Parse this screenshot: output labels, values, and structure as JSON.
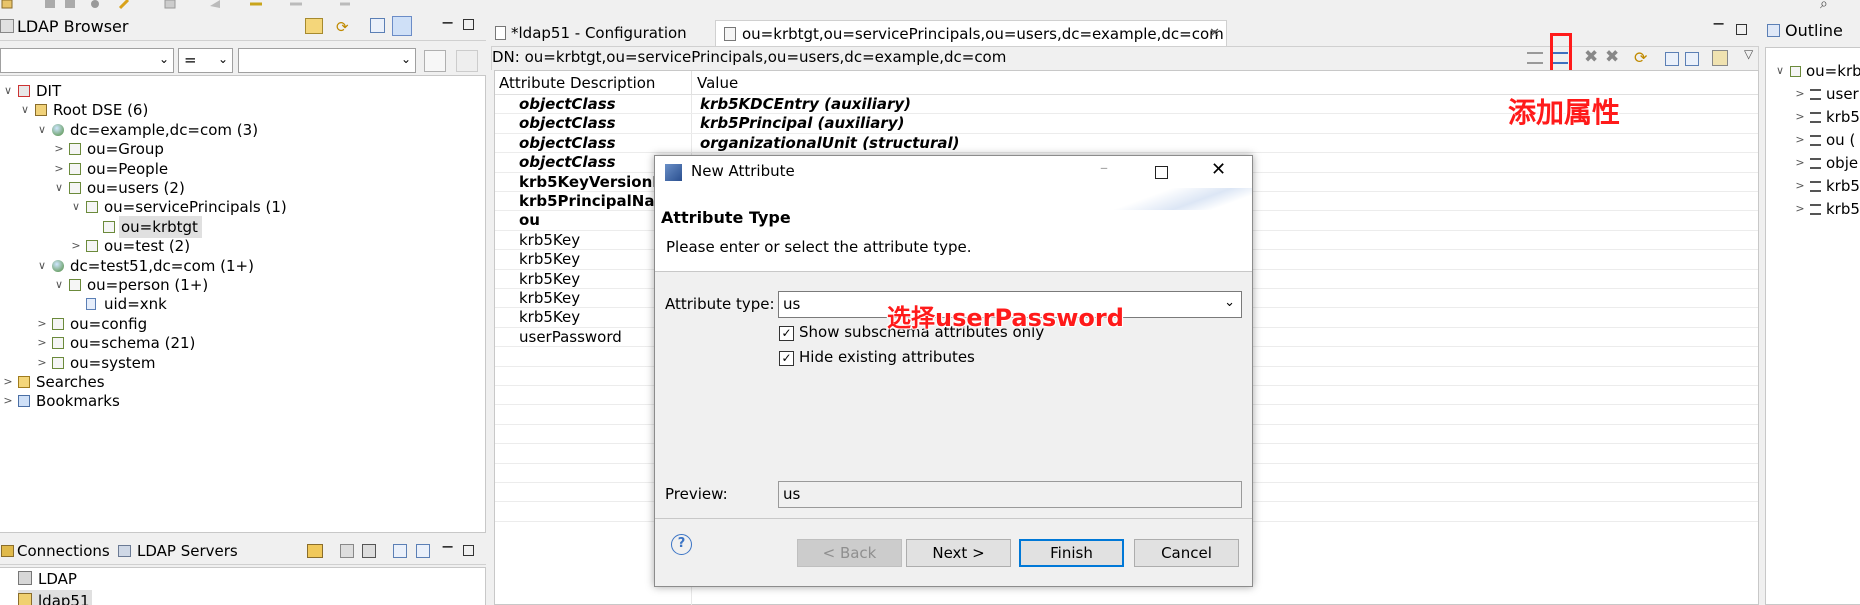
{
  "left_panel": {
    "title": "LDAP Browser",
    "filter_operator": "=",
    "tree": [
      {
        "label": "DIT",
        "depth": 0,
        "twist": "∨",
        "icon": "dit"
      },
      {
        "label": "Root DSE (6)",
        "depth": 1,
        "twist": "∨",
        "icon": "root"
      },
      {
        "label": "dc=example,dc=com (3)",
        "depth": 2,
        "twist": "∨",
        "icon": "globe"
      },
      {
        "label": "ou=Group",
        "depth": 3,
        "twist": ">",
        "icon": "ou"
      },
      {
        "label": "ou=People",
        "depth": 3,
        "twist": ">",
        "icon": "ou"
      },
      {
        "label": "ou=users (2)",
        "depth": 3,
        "twist": "∨",
        "icon": "ou"
      },
      {
        "label": "ou=servicePrincipals (1)",
        "depth": 4,
        "twist": "∨",
        "icon": "ou"
      },
      {
        "label": "ou=krbtgt",
        "depth": 5,
        "twist": "",
        "icon": "ou",
        "selected": true
      },
      {
        "label": "ou=test (2)",
        "depth": 4,
        "twist": ">",
        "icon": "ou"
      },
      {
        "label": "dc=test51,dc=com (1+)",
        "depth": 2,
        "twist": "∨",
        "icon": "globe"
      },
      {
        "label": "ou=person (1+)",
        "depth": 3,
        "twist": "∨",
        "icon": "ou"
      },
      {
        "label": "uid=xnk",
        "depth": 4,
        "twist": "",
        "icon": "person"
      },
      {
        "label": "ou=config",
        "depth": 2,
        "twist": ">",
        "icon": "ou"
      },
      {
        "label": "ou=schema (21)",
        "depth": 2,
        "twist": ">",
        "icon": "ou"
      },
      {
        "label": "ou=system",
        "depth": 2,
        "twist": ">",
        "icon": "ou"
      },
      {
        "label": "Searches",
        "depth": 0,
        "twist": ">",
        "icon": "search"
      },
      {
        "label": "Bookmarks",
        "depth": 0,
        "twist": ">",
        "icon": "bookmark"
      }
    ]
  },
  "connections_panel": {
    "tab_connections": "Connections",
    "tab_servers": "LDAP Servers",
    "items": [
      "LDAP",
      "ldap51"
    ]
  },
  "editor": {
    "tab_config": "*ldap51 - Configuration",
    "tab_entry": "ou=krbtgt,ou=servicePrincipals,ou=users,dc=example,dc=com",
    "dn_label": "DN: ou=krbtgt,ou=servicePrincipals,ou=users,dc=example,dc=com",
    "col_attr": "Attribute Description",
    "col_value": "Value",
    "rows": [
      {
        "attr": "objectClass",
        "value": "krb5KDCEntry (auxiliary)",
        "style": "bi"
      },
      {
        "attr": "objectClass",
        "value": "krb5Principal (auxiliary)",
        "style": "bi"
      },
      {
        "attr": "objectClass",
        "value": "organizationalUnit (structural)",
        "style": "bi"
      },
      {
        "attr": "objectClass",
        "value": "",
        "style": "bi"
      },
      {
        "attr": "krb5KeyVersionNu",
        "value": "",
        "style": "b"
      },
      {
        "attr": "krb5PrincipalName",
        "value": "",
        "style": "b"
      },
      {
        "attr": "ou",
        "value": "",
        "style": "b"
      },
      {
        "attr": "krb5Key",
        "value": "",
        "style": ""
      },
      {
        "attr": "krb5Key",
        "value": "",
        "style": ""
      },
      {
        "attr": "krb5Key",
        "value": "",
        "style": ""
      },
      {
        "attr": "krb5Key",
        "value": "",
        "style": ""
      },
      {
        "attr": "krb5Key",
        "value": "",
        "style": ""
      },
      {
        "attr": "userPassword",
        "value": "",
        "style": ""
      }
    ]
  },
  "outline_panel": {
    "title": "Outline",
    "items": [
      "ou=krb",
      "user",
      "krb5",
      "ou (",
      "obje",
      "krb5",
      "krb5"
    ]
  },
  "dialog": {
    "title": "New Attribute",
    "heading": "Attribute Type",
    "description": "Please enter or select the attribute type.",
    "attr_type_label": "Attribute type:",
    "attr_type_value": "us",
    "show_subschema_label": "Show subschema attributes only",
    "show_subschema_checked": true,
    "hide_existing_label": "Hide existing attributes",
    "hide_existing_checked": true,
    "preview_label": "Preview:",
    "preview_value": "us",
    "back_label": "< Back",
    "next_label": "Next >",
    "finish_label": "Finish",
    "cancel_label": "Cancel"
  },
  "annotations": {
    "add_attribute": "添加属性",
    "select_user_password": "选择userPassword"
  },
  "colors": {
    "annotation_red": "#ff1a1a",
    "selection": "#e0e0e0",
    "primary_border": "#0078d7"
  }
}
